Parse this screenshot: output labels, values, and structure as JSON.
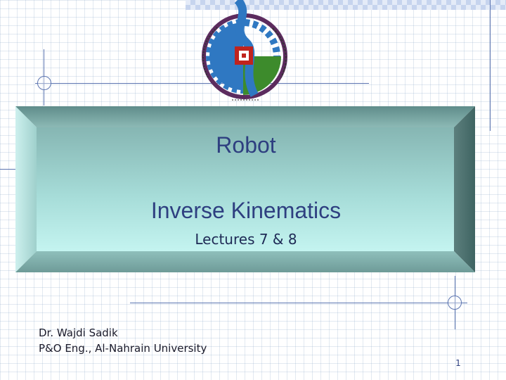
{
  "slide": {
    "title": "Robot",
    "main_title": "Inverse Kinematics",
    "subtitle": "Lectures 7 & 8",
    "author_name": "Dr. Wajdi Sadik",
    "author_affiliation": "P&O Eng., Al-Nahrain University",
    "slide_number": "1"
  },
  "logo": {
    "icon": "university-emblem-icon",
    "colors": {
      "blue": "#2f78c2",
      "green": "#3d8b2c",
      "red": "#c0231d",
      "purple": "#5c2b5e"
    }
  },
  "theme": {
    "title_color": "#2e3f80",
    "panel_face": "#b8ece7",
    "accent_line": "#5b74b0"
  }
}
